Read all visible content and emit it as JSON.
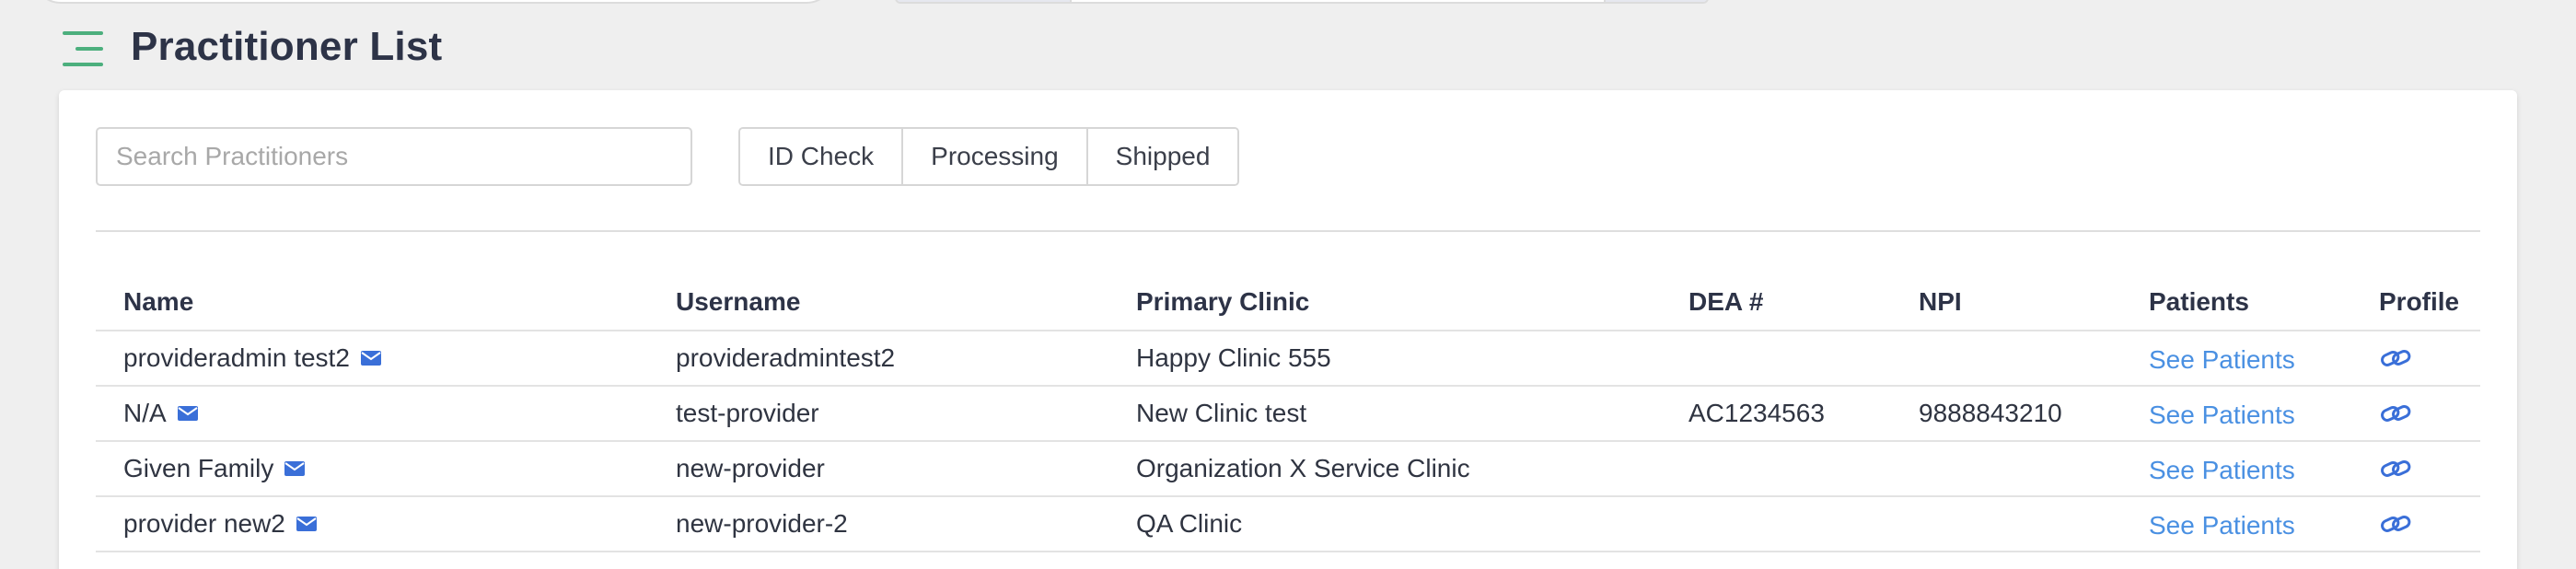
{
  "header": {
    "title": "Practitioner List"
  },
  "search": {
    "placeholder": "Search Practitioners",
    "value": ""
  },
  "filters": [
    {
      "label": "ID Check"
    },
    {
      "label": "Processing"
    },
    {
      "label": "Shipped"
    }
  ],
  "table": {
    "columns": {
      "name": "Name",
      "username": "Username",
      "clinic": "Primary Clinic",
      "dea": "DEA #",
      "npi": "NPI",
      "patients": "Patients",
      "profile": "Profile"
    },
    "rows": [
      {
        "name": "provideradmin test2",
        "username": "provideradmintest2",
        "clinic": "Happy Clinic 555",
        "dea": "",
        "npi": "",
        "patients": "See Patients"
      },
      {
        "name": "N/A",
        "username": "test-provider",
        "clinic": "New Clinic test",
        "dea": "AC1234563",
        "npi": "9888843210",
        "patients": "See Patients"
      },
      {
        "name": "Given Family",
        "username": "new-provider",
        "clinic": "Organization X Service Clinic",
        "dea": "",
        "npi": "",
        "patients": "See Patients"
      },
      {
        "name": "provider new2",
        "username": "new-provider-2",
        "clinic": "QA Clinic",
        "dea": "",
        "npi": "",
        "patients": "See Patients"
      }
    ]
  },
  "icons": {
    "menu": "hamburger-menu-icon",
    "mail": "envelope-icon",
    "profile": "link-icon"
  },
  "colors": {
    "accent_green": "#4caf7d",
    "link_blue": "#4a90e2",
    "icon_blue": "#3a6fd8",
    "title": "#2d3347"
  }
}
